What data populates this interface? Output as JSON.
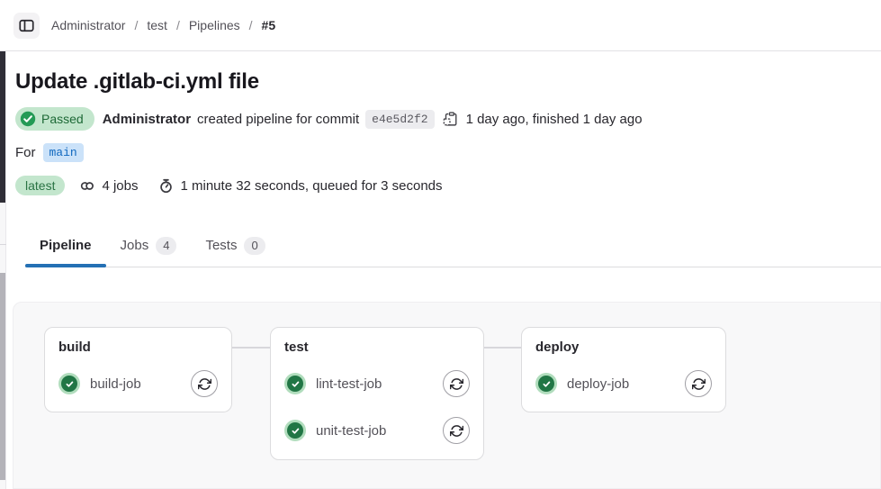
{
  "breadcrumb": {
    "separator": "/",
    "items": [
      {
        "label": "Administrator"
      },
      {
        "label": "test"
      },
      {
        "label": "Pipelines"
      },
      {
        "label": "#5"
      }
    ]
  },
  "header": {
    "title": "Update .gitlab-ci.yml file",
    "status_label": "Passed",
    "author": "Administrator",
    "action_text": "created pipeline for commit",
    "commit_sha": "e4e5d2f2",
    "time_text": "1 day ago, finished 1 day ago",
    "ref_prefix": "For",
    "branch": "main",
    "latest_label": "latest",
    "jobs_text": "4 jobs",
    "duration_text": "1 minute 32 seconds, queued for 3 seconds"
  },
  "tabs": [
    {
      "label": "Pipeline",
      "count": ""
    },
    {
      "label": "Jobs",
      "count": "4"
    },
    {
      "label": "Tests",
      "count": "0"
    }
  ],
  "pipeline": {
    "stages": [
      {
        "name": "build",
        "jobs": [
          {
            "name": "build-job",
            "status": "success"
          }
        ]
      },
      {
        "name": "test",
        "jobs": [
          {
            "name": "lint-test-job",
            "status": "success"
          },
          {
            "name": "unit-test-job",
            "status": "success"
          }
        ]
      },
      {
        "name": "deploy",
        "jobs": [
          {
            "name": "deploy-job",
            "status": "success"
          }
        ]
      }
    ]
  },
  "colors": {
    "accent_blue": "#2470b4",
    "link_blue": "#1068bf",
    "success_badge_bg": "#c3e6cd",
    "success_badge_text": "#1d6936",
    "success_icon": "#217645",
    "neutral_badge_bg": "#ececef",
    "branch_badge_bg": "#cbe2f9",
    "card_border": "#dcdcde",
    "panel_bg": "#f8f8f9"
  }
}
